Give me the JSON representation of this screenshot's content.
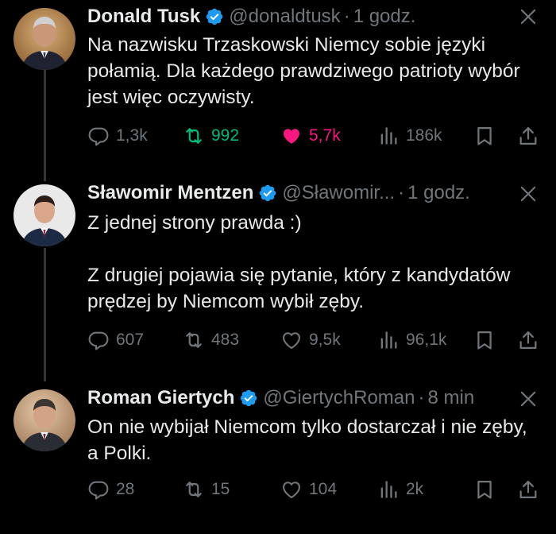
{
  "colors": {
    "background": "#000000",
    "text": "#e7e9ea",
    "muted": "#71767b",
    "retweet_active": "#00ba7c",
    "like_active": "#f91880",
    "verified": "#1d9bf0"
  },
  "tweets": [
    {
      "name": "Donald Tusk",
      "handle": "@donaldtusk",
      "separator": "·",
      "time": "1 godz.",
      "paragraphs": [
        "Na nazwisku Trzaskowski Niemcy sobie języki połamią. Dla każdego prawdziwego patrioty wybór jest więc oczywisty."
      ],
      "replies": "1,3k",
      "retweets": "992",
      "likes": "5,7k",
      "views": "186k",
      "retweeted": true,
      "liked": true
    },
    {
      "name": "Sławomir Mentzen",
      "handle": "@Sławomir...",
      "separator": "·",
      "time": "1 godz.",
      "paragraphs": [
        "Z jednej strony prawda :)",
        "",
        "Z drugiej pojawia się pytanie, który z kandydatów prędzej by Niemcom wybił zęby."
      ],
      "replies": "607",
      "retweets": "483",
      "likes": "9,5k",
      "views": "96,1k",
      "retweeted": false,
      "liked": false
    },
    {
      "name": "Roman Giertych",
      "handle": "@GiertychRoman",
      "separator": "·",
      "time": "8 min",
      "paragraphs": [
        "On nie wybijał Niemcom tylko dostarczał i nie zęby, a Polki."
      ],
      "replies": "28",
      "retweets": "15",
      "likes": "104",
      "views": "2k",
      "retweeted": false,
      "liked": false
    }
  ]
}
